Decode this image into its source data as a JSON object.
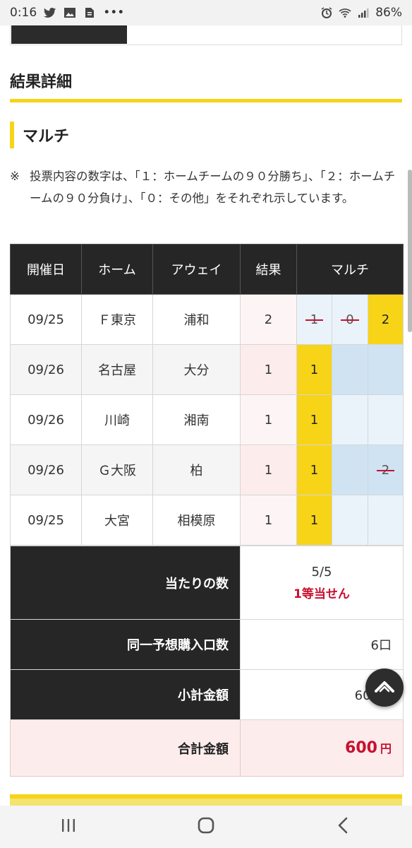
{
  "status_bar": {
    "time": "0:16",
    "battery": "86%",
    "more": "•••"
  },
  "section": {
    "title": "結果詳細"
  },
  "subsection": {
    "title": "マルチ"
  },
  "note": {
    "mark": "※",
    "text": "投票内容の数字は、「１：ホームチームの９０分勝ち」、「２：ホームチームの９０分負け」、「０：その他」をそれぞれ示しています。"
  },
  "table": {
    "headers": {
      "date": "開催日",
      "home": "ホーム",
      "away": "アウェイ",
      "result": "結果",
      "multi": "マルチ"
    },
    "rows": [
      {
        "date": "09/25",
        "home": "Ｆ東京",
        "away": "浦和",
        "result": "2",
        "m1": "1",
        "m2": "0",
        "m3": "2"
      },
      {
        "date": "09/26",
        "home": "名古屋",
        "away": "大分",
        "result": "1",
        "m1": "1",
        "m2": "",
        "m3": ""
      },
      {
        "date": "09/26",
        "home": "川崎",
        "away": "湘南",
        "result": "1",
        "m1": "1",
        "m2": "",
        "m3": ""
      },
      {
        "date": "09/26",
        "home": "Ｇ大阪",
        "away": "柏",
        "result": "1",
        "m1": "1",
        "m2": "",
        "m3": "2"
      },
      {
        "date": "09/25",
        "home": "大宮",
        "away": "相模原",
        "result": "1",
        "m1": "1",
        "m2": "",
        "m3": ""
      }
    ]
  },
  "summary": {
    "hits_label": "当たりの数",
    "hits_value": "5/5",
    "prize": "1等当せん",
    "units_label": "同一予想購入口数",
    "units_value": "6口",
    "subtotal_label": "小計金額",
    "subtotal_value": "600円",
    "total_label": "合計金額",
    "total_amount": "600",
    "total_unit": "円"
  },
  "colors": {
    "accent_yellow": "#f7d417",
    "header_dark": "#262626",
    "prize_red": "#c8102e"
  },
  "icons": [
    "twitter-icon",
    "image-icon",
    "file-icon",
    "alarm-icon",
    "wifi-icon",
    "signal-icon",
    "chevron-up-icon",
    "recent-apps-icon",
    "home-icon",
    "back-icon"
  ]
}
